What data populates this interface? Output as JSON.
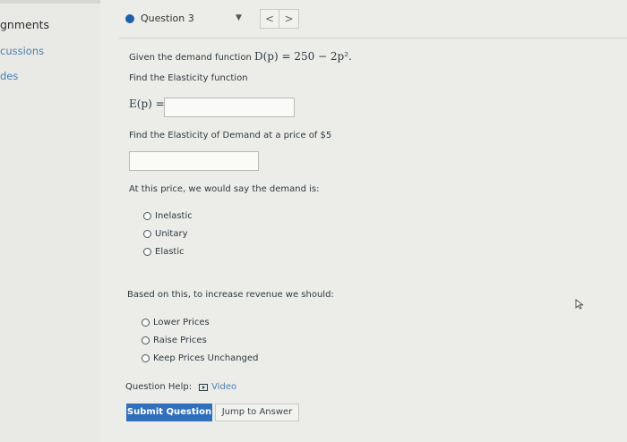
{
  "sidebar": {
    "items": [
      {
        "label": "gnments"
      },
      {
        "label": "cussions"
      },
      {
        "label": "des"
      }
    ]
  },
  "question_nav": {
    "label": "Question 3",
    "prev": "<",
    "next": ">"
  },
  "content": {
    "intro_text": "Given the demand function",
    "intro_formula": "D(p) = 250 − 2p².",
    "find_function": "Find the Elasticity function",
    "ep_label": "E(p) =",
    "ep_value": "",
    "find_at_price": "Find the Elasticity of Demand at a price of $5",
    "elasticity_value": "",
    "demand_question": "At this price, we would say the demand is:",
    "demand_options": [
      "Inelastic",
      "Unitary",
      "Elastic"
    ],
    "revenue_question": "Based on this, to increase revenue we should:",
    "revenue_options": [
      "Lower Prices",
      "Raise Prices",
      "Keep Prices Unchanged"
    ],
    "help_label": "Question Help:",
    "video_label": "Video",
    "submit_label": "Submit Question",
    "jump_label": "Jump to Answer"
  }
}
